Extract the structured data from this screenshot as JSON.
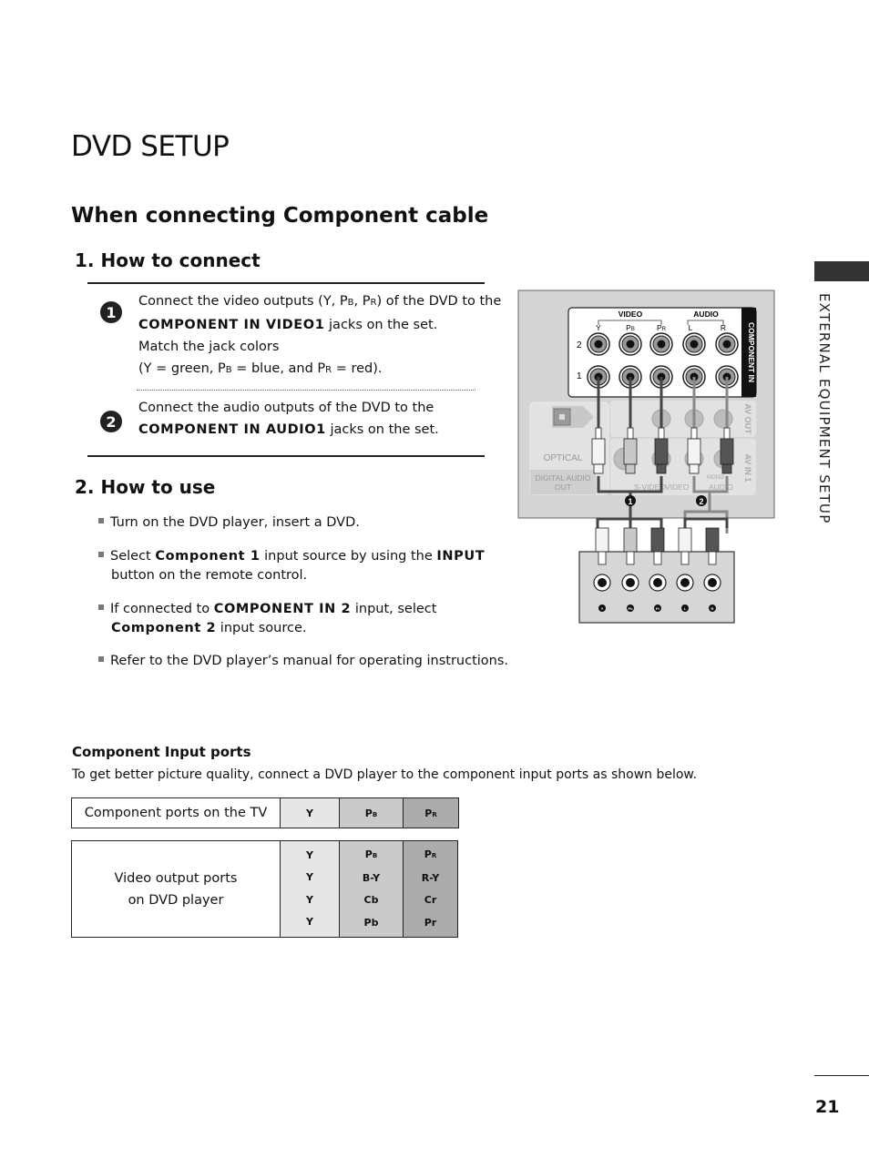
{
  "page": {
    "title": "DVD SETUP",
    "subtitle": "When connecting Component cable",
    "sidebar_label": "EXTERNAL EQUIPMENT SETUP",
    "page_number": "21"
  },
  "how_to_connect": {
    "heading": "1. How to connect",
    "steps": [
      {
        "badge": "1",
        "line1_pre": "Connect the video outputs (Y, P",
        "line1_sub1": "B",
        "line1_mid": ", P",
        "line1_sub2": "R",
        "line1_post": ")  of the DVD to the",
        "line2_bold": "COMPONENT IN VIDEO1",
        "line2_post": " jacks on the set.",
        "line3": "Match the jack colors",
        "line4_a": "(Y = green, P",
        "line4_sub1": "B",
        "line4_b": " = blue, and P",
        "line4_sub2": "R",
        "line4_c": " = red)."
      },
      {
        "badge": "2",
        "line1": "Connect the audio outputs of the DVD to the",
        "line2_bold": "COMPONENT IN AUDIO1",
        "line2_post": " jacks on the set."
      }
    ]
  },
  "how_to_use": {
    "heading": "2. How to use",
    "bullets": [
      {
        "text": "Turn on the DVD player, insert a DVD."
      },
      {
        "pre": "Select ",
        "bold": "Component 1",
        "post": " input source by using the ",
        "bold2": "INPUT",
        "line2": "button on the remote control."
      },
      {
        "pre": "If connected to ",
        "bold": "COMPONENT IN 2",
        "post": " input, select",
        "bold2": "Component 2",
        "line2": " input source."
      },
      {
        "text": "Refer to the DVD player’s manual for operating instructions."
      }
    ]
  },
  "diagram": {
    "video_label": "VIDEO",
    "audio_label": "AUDIO",
    "jack_labels": [
      "Y",
      "PB",
      "PR",
      "L",
      "R"
    ],
    "row_labels": [
      "2",
      "1"
    ],
    "component_in_label": "COMPONENT IN",
    "av_out_label": "AV OUT",
    "av_in_label": "AV IN 1",
    "optical_label": "OPTICAL",
    "digital_audio_out_label": "DIGITAL AUDIO OUT",
    "s_video_label": "S-VIDEO",
    "video_small_label": "VIDEO",
    "mono_label": "MONO",
    "audio_small_label": "AUDIO",
    "callouts": [
      "1",
      "2"
    ],
    "dvd_jack_labels": [
      "Y",
      "PB",
      "PR",
      "L",
      "R"
    ]
  },
  "component_ports": {
    "heading": "Component Input ports",
    "description": "To get better picture quality, connect a DVD player to the component input ports as shown below.",
    "tv_row_label": "Component ports on the TV",
    "tv_ports": [
      "Y",
      "PB",
      "PR"
    ],
    "dvd_row_label_1": "Video output ports",
    "dvd_row_label_2": "on DVD player",
    "dvd_rows": [
      [
        "Y",
        "PB",
        "PR"
      ],
      [
        "Y",
        "B-Y",
        "R-Y"
      ],
      [
        "Y",
        "Cb",
        "Cr"
      ],
      [
        "Y",
        "Pb",
        "Pr"
      ]
    ]
  }
}
